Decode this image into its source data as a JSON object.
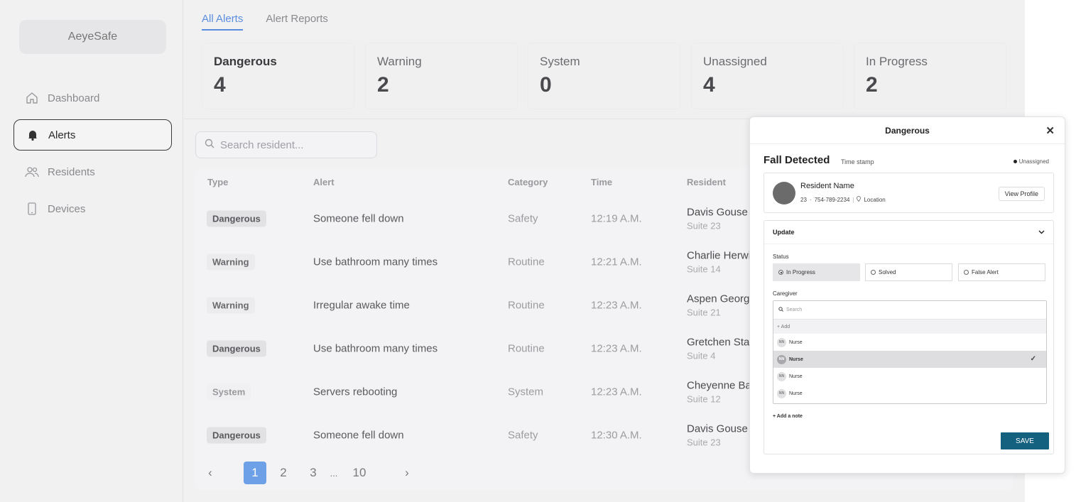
{
  "app": {
    "logo": "AeyeSafe"
  },
  "sidebar": {
    "items": [
      {
        "label": "Dashboard",
        "icon": "home-icon"
      },
      {
        "label": "Alerts",
        "icon": "bell-icon",
        "active": true
      },
      {
        "label": "Residents",
        "icon": "users-icon"
      },
      {
        "label": "Devices",
        "icon": "device-icon"
      }
    ]
  },
  "tabs": [
    {
      "label": "All Alerts",
      "active": true
    },
    {
      "label": "Alert Reports"
    }
  ],
  "stats": [
    {
      "label": "Dangerous",
      "value": "4"
    },
    {
      "label": "Warning",
      "value": "2"
    },
    {
      "label": "System",
      "value": "0"
    },
    {
      "label": "Unassigned",
      "value": "4"
    },
    {
      "label": "In Progress",
      "value": "2"
    }
  ],
  "search": {
    "placeholder": "Search resident..."
  },
  "table": {
    "headers": [
      "Type",
      "Alert",
      "Category",
      "Time",
      "Resident"
    ],
    "rows": [
      {
        "type": "Dangerous",
        "alert": "Someone fell down",
        "category": "Safety",
        "time": "12:19 A.M.",
        "resident": "Davis Gouse",
        "suite": "Suite 23"
      },
      {
        "type": "Warning",
        "alert": "Use bathroom many times",
        "category": "Routine",
        "time": "12:21 A.M.",
        "resident": "Charlie Herwi",
        "suite": "Suite 14"
      },
      {
        "type": "Warning",
        "alert": "Irregular awake time",
        "category": "Routine",
        "time": "12:23 A.M.",
        "resident": "Aspen George",
        "suite": "Suite 21"
      },
      {
        "type": "Dangerous",
        "alert": "Use bathroom many times",
        "category": "Routine",
        "time": "12:23 A.M.",
        "resident": "Gretchen Star",
        "suite": "Suite 4"
      },
      {
        "type": "System",
        "alert": "Servers rebooting",
        "category": "System",
        "time": "12:23 A.M.",
        "resident": "Cheyenne Ba",
        "suite": "Suite 12"
      },
      {
        "type": "Dangerous",
        "alert": "Someone fell down",
        "category": "Safety",
        "time": "12:30 A.M.",
        "resident": "Davis Gouse",
        "suite": "Suite 23"
      }
    ]
  },
  "pagination": {
    "prev": "‹",
    "pages": [
      "1",
      "2",
      "3"
    ],
    "ellipsis": "...",
    "last": "10",
    "next": "›",
    "current": "1"
  },
  "modal": {
    "title": "Dangerous",
    "close": "✕",
    "event": "Fall Detected",
    "timestamp": "Time stamp",
    "assignment": "Unassigned",
    "resident": {
      "name": "Resident Name",
      "age": "23",
      "phone": "754-789-2234",
      "location": "Location",
      "view_profile": "View Profile"
    },
    "update": {
      "title": "Update",
      "status_label": "Status",
      "status_options": [
        {
          "label": "In Progress",
          "selected": true
        },
        {
          "label": "Solved",
          "selected": false
        },
        {
          "label": "False Alert",
          "selected": false
        }
      ],
      "caregiver_label": "Caregiver",
      "caregiver_search": "Search",
      "caregiver_add": "+ Add",
      "caregivers": [
        {
          "initials": "NN",
          "name": "Nurse",
          "selected": false
        },
        {
          "initials": "NN",
          "name": "Nurse",
          "selected": true
        },
        {
          "initials": "NN",
          "name": "Nurse",
          "selected": false
        },
        {
          "initials": "NN",
          "name": "Nurse",
          "selected": false
        }
      ],
      "add_note": "+ Add a note",
      "save": "SAVE"
    }
  },
  "colors": {
    "accent": "#5b8ddf",
    "save": "#14607f",
    "page_active": "#6ea0e8"
  }
}
